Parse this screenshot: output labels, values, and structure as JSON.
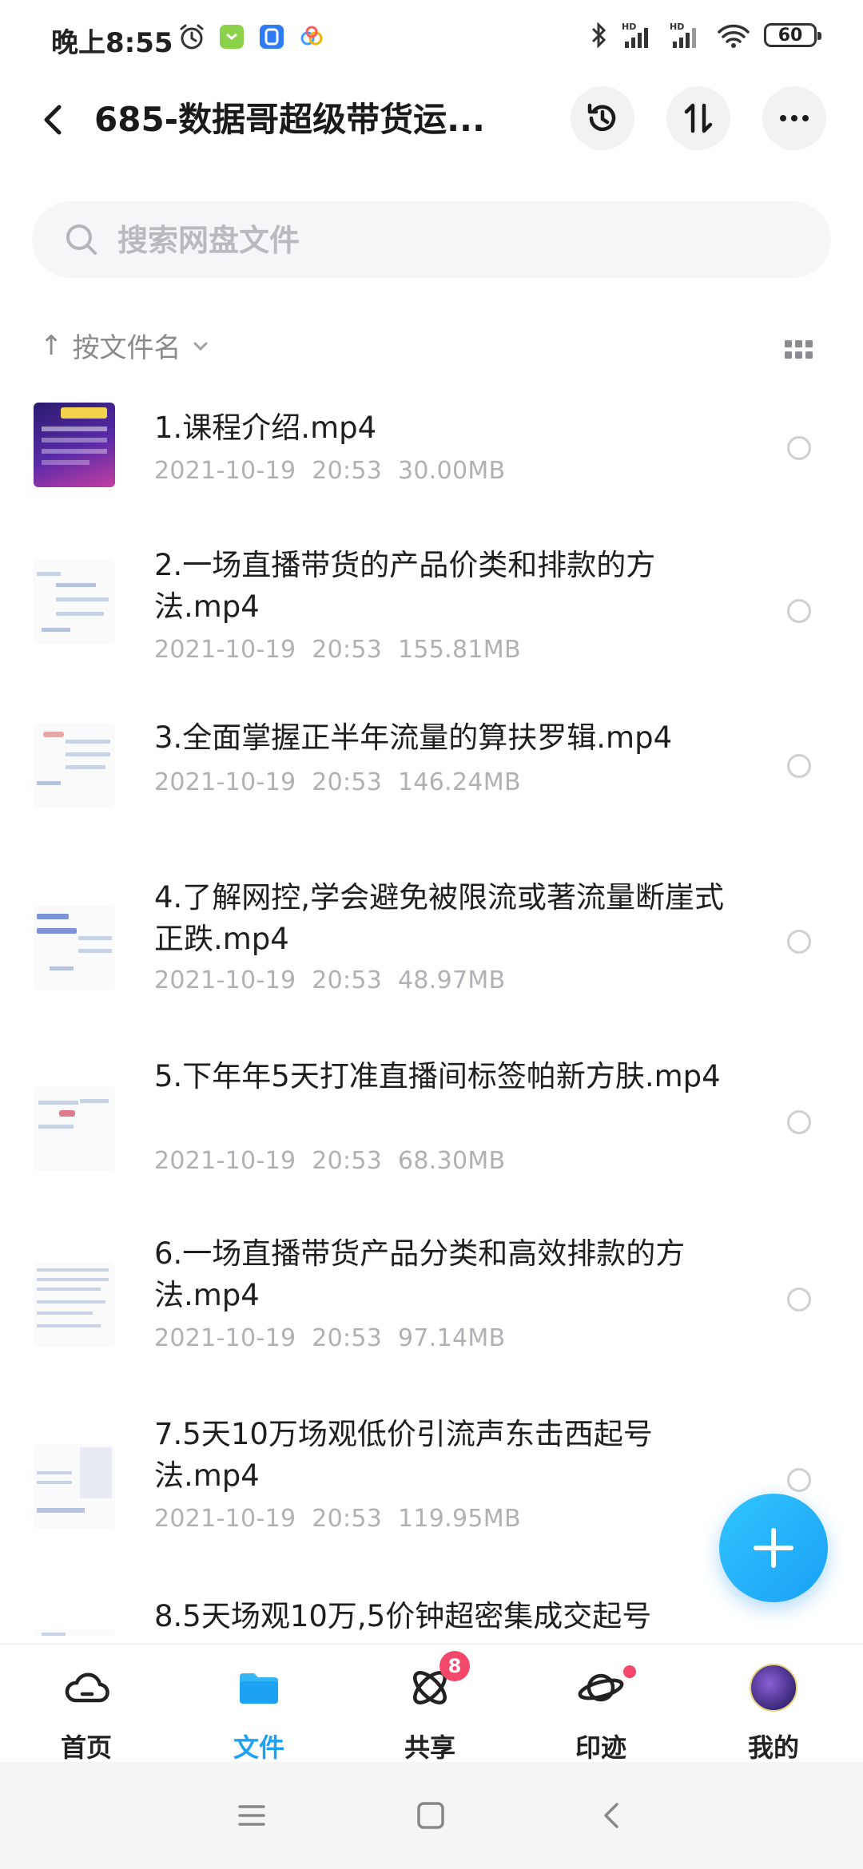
{
  "status_bar": {
    "time": "晚上8:55",
    "battery": "60",
    "icons_left": [
      "alarm-icon",
      "app-notification-icon",
      "app-notification-icon",
      "baidu-netdisk-icon"
    ],
    "icons_right": [
      "bluetooth-icon",
      "signal-hd-icon",
      "signal-hd-icon",
      "wifi-icon",
      "battery-icon"
    ]
  },
  "header": {
    "title": "685-数据哥超级带货运...",
    "actions": [
      "history-icon",
      "sort-swap-icon",
      "more-icon"
    ]
  },
  "search": {
    "placeholder": "搜索网盘文件"
  },
  "sort": {
    "label": "按文件名",
    "arrow": "↑"
  },
  "files": [
    {
      "name": "1.课程介绍.mp4",
      "date": "2021-10-19",
      "time": "20:53",
      "size": "30.00MB"
    },
    {
      "name": "2.一场直播带货的产品价类和排款的方法.mp4",
      "date": "2021-10-19",
      "time": "20:53",
      "size": "155.81MB"
    },
    {
      "name": "3.全面掌握正半年流量的算扶罗辑.mp4",
      "date": "2021-10-19",
      "time": "20:53",
      "size": "146.24MB"
    },
    {
      "name": "4.了解网控,学会避免被限流或著流量断崖式正跌.mp4",
      "date": "2021-10-19",
      "time": "20:53",
      "size": "48.97MB"
    },
    {
      "name": "5.下年年5天打准直播间标签帕新方肤.mp4",
      "date": "2021-10-19",
      "time": "20:53",
      "size": "68.30MB"
    },
    {
      "name": "6.一场直播带货产品分类和高效排款的方法.mp4",
      "date": "2021-10-19",
      "time": "20:53",
      "size": "97.14MB"
    },
    {
      "name": "7.5天10万场观低价引流声东击西起号法.mp4",
      "date": "2021-10-19",
      "time": "20:53",
      "size": "119.95MB"
    },
    {
      "name": "8.5天场观10万,5价钟超密集成交起号",
      "date": "",
      "time": "",
      "size": ""
    }
  ],
  "bottom_nav": [
    {
      "label": "首页",
      "icon": "cloud-home-icon",
      "active": false
    },
    {
      "label": "文件",
      "icon": "folder-icon",
      "active": true
    },
    {
      "label": "共享",
      "icon": "share-orbit-icon",
      "active": false,
      "badge": "8"
    },
    {
      "label": "印迹",
      "icon": "planet-icon",
      "active": false,
      "dot": true
    },
    {
      "label": "我的",
      "icon": "avatar",
      "active": false
    }
  ],
  "colors": {
    "accent": "#1da1f2",
    "badge": "#f4486a",
    "meta_text": "#b0b0b5"
  }
}
